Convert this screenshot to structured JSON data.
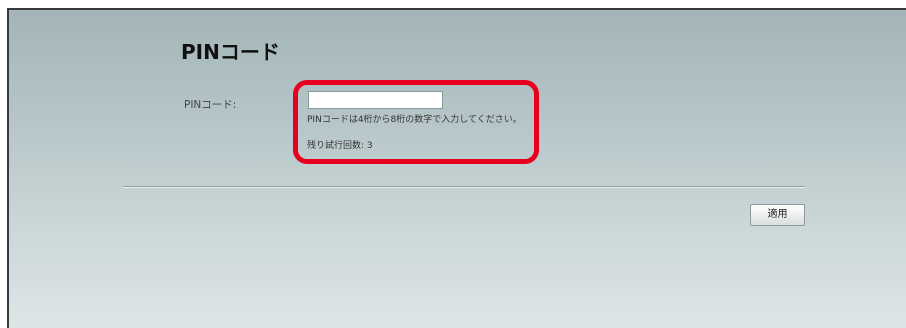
{
  "page": {
    "title": "PINコード"
  },
  "form": {
    "pin_label": "PINコード:",
    "pin_value": "",
    "pin_placeholder": "",
    "hint": "PINコードは4桁から8桁の数字で入力してください。",
    "remaining_attempts": "残り試行回数: 3"
  },
  "actions": {
    "apply_label": "適用"
  },
  "colors": {
    "highlight": "#e8001f",
    "background_top": "#a3b5b8",
    "background_bottom": "#dde5e7"
  }
}
